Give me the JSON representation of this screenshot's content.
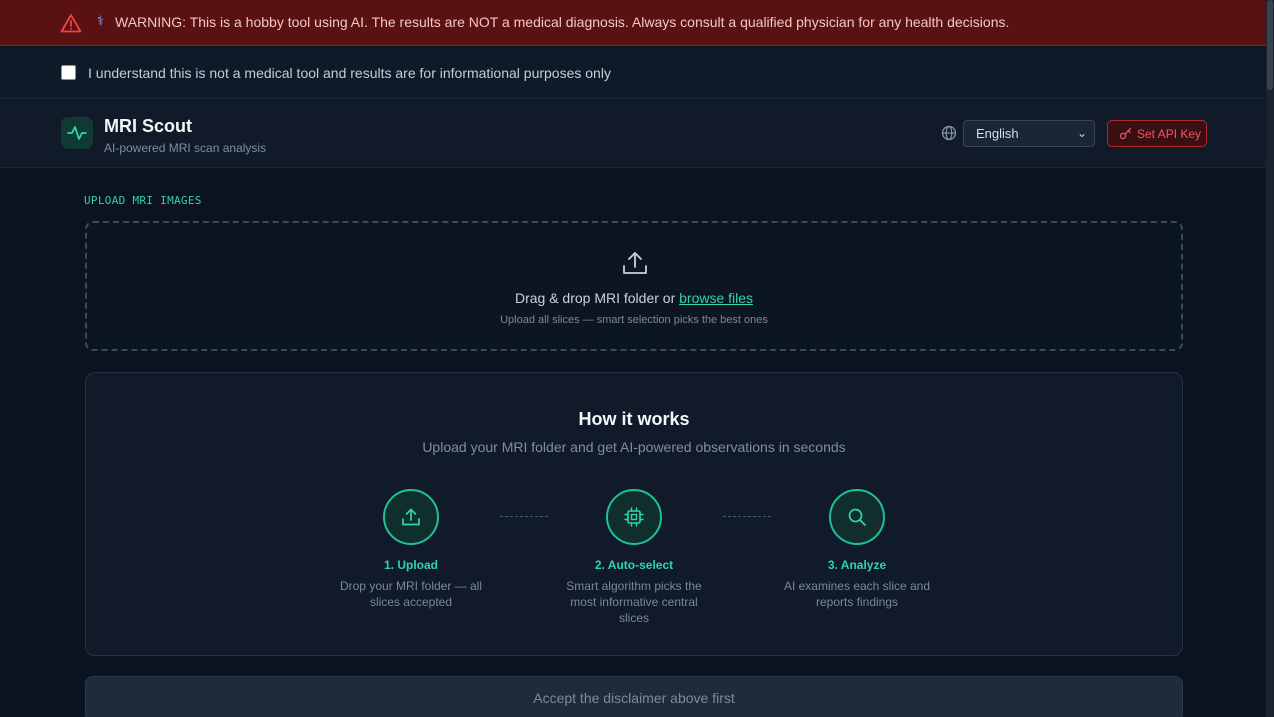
{
  "warning": {
    "text": "WARNING: This is a hobby tool using AI. The results are NOT a medical diagnosis. Always consult a qualified physician for any health decisions.",
    "icon": "warning-triangle-icon",
    "badge_icon": "caduceus-icon",
    "badge_glyph": "⚕"
  },
  "disclaimer": {
    "label": "I understand this is not a medical tool and results are for informational purposes only",
    "checked": false
  },
  "header": {
    "title": "MRI Scout",
    "subtitle": "AI-powered MRI scan analysis",
    "language": "English",
    "api_button": "Set API Key"
  },
  "upload": {
    "section_label": "UPLOAD MRI IMAGES",
    "drop_text": "Drag & drop MRI folder or ",
    "browse_link": "browse files",
    "hint": "Upload all slices — smart selection picks the best ones"
  },
  "how_it_works": {
    "title": "How it works",
    "subtitle": "Upload your MRI folder and get AI-powered observations in seconds",
    "steps": [
      {
        "title": "1. Upload",
        "desc": "Drop your MRI folder — all slices accepted",
        "icon": "upload-icon"
      },
      {
        "title": "2. Auto-select",
        "desc": "Smart algorithm picks the most informative central slices",
        "icon": "chip-icon"
      },
      {
        "title": "3. Analyze",
        "desc": "AI examines each slice and reports findings",
        "icon": "search-icon"
      }
    ]
  },
  "submit": {
    "label": "Accept the disclaimer above first",
    "enabled": false
  },
  "colors": {
    "accent": "#2fd3b0",
    "warning_bg": "#5a1111",
    "danger": "#f0555d",
    "background": "#0b1320"
  }
}
